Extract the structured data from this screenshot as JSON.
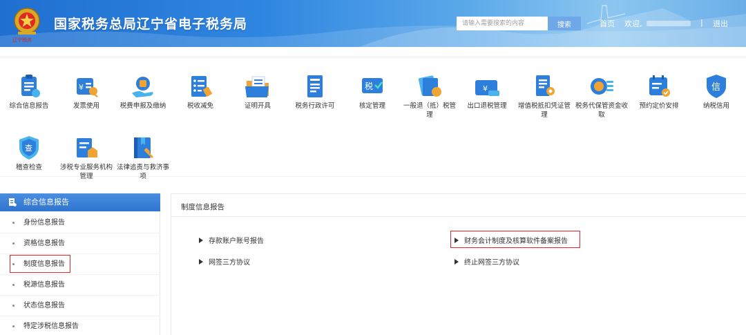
{
  "header": {
    "title": "国家税务总局辽宁省电子税务局",
    "emblem_sub": "辽宁税务",
    "search_placeholder": "请输入需要搜索的内容",
    "search_button": "搜索",
    "home_link": "首页",
    "welcome_text": "欢迎,",
    "separator": "|",
    "logout_link": "退出"
  },
  "menu": [
    {
      "label": "综合信息报告",
      "icon": "clipboard-report-icon"
    },
    {
      "label": "发票使用",
      "icon": "invoice-icon"
    },
    {
      "label": "税费申报及缴纳",
      "icon": "tax-payment-icon"
    },
    {
      "label": "税收减免",
      "icon": "tax-relief-icon"
    },
    {
      "label": "证明开具",
      "icon": "certificate-folder-icon"
    },
    {
      "label": "税务行政许可",
      "icon": "admin-license-icon"
    },
    {
      "label": "核定管理",
      "icon": "assessment-icon"
    },
    {
      "label": "一般退（抵）税管理",
      "icon": "refund-icon"
    },
    {
      "label": "出口退税管理",
      "icon": "export-refund-icon"
    },
    {
      "label": "增值税抵扣凭证管理",
      "icon": "vat-voucher-icon"
    },
    {
      "label": "税务代保管资金收取",
      "icon": "fund-custody-icon"
    },
    {
      "label": "预约定价安排",
      "icon": "pricing-calendar-icon"
    },
    {
      "label": "纳税信用",
      "icon": "credit-shield-icon"
    },
    {
      "label": "稽查检查",
      "icon": "inspection-shield-icon"
    },
    {
      "label": "涉税专业服务机构管理",
      "icon": "service-agency-icon"
    },
    {
      "label": "法律追责与救济事项",
      "icon": "legal-book-icon"
    }
  ],
  "sidebar": {
    "title": "综合信息报告",
    "items": [
      {
        "label": "身份信息报告"
      },
      {
        "label": "资格信息报告"
      },
      {
        "label": "制度信息报告",
        "selected": true
      },
      {
        "label": "税源信息报告"
      },
      {
        "label": "状态信息报告"
      },
      {
        "label": "特定涉税信息报告"
      }
    ]
  },
  "content": {
    "title": "制度信息报告",
    "links": [
      {
        "label": "存款账户账号报告"
      },
      {
        "label": "财务会计制度及核算软件备案报告",
        "highlighted": true
      },
      {
        "label": "网签三方协议"
      },
      {
        "label": "终止网签三方协议"
      }
    ]
  },
  "colors": {
    "brand_blue": "#2f74cf",
    "highlight_red": "#e0262a"
  }
}
